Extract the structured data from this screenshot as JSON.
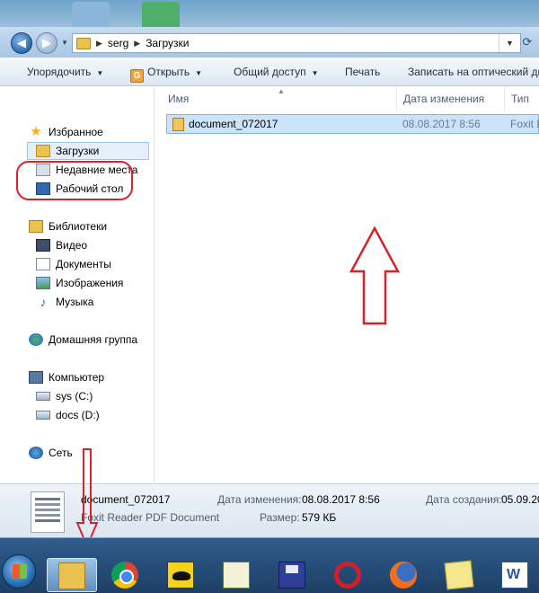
{
  "window": {
    "breadcrumb": [
      "serg",
      "Загрузки"
    ]
  },
  "toolbar": {
    "organize": "Упорядочить",
    "open": "Открыть",
    "share": "Общий доступ",
    "print": "Печать",
    "burn": "Записать на оптический диск"
  },
  "nav": {
    "favorites": "Избранное",
    "downloads": "Загрузки",
    "recent": "Недавние места",
    "desktop": "Рабочий стол",
    "libraries": "Библиотеки",
    "video": "Видео",
    "documents": "Документы",
    "images": "Изображения",
    "music": "Музыка",
    "homegroup": "Домашняя группа",
    "computer": "Компьютер",
    "drive_c": "sys (C:)",
    "drive_d": "docs (D:)",
    "network": "Сеть"
  },
  "columns": {
    "name": "Имя",
    "date_modified": "Дата изменения",
    "type": "Тип"
  },
  "files": [
    {
      "name": "document_072017",
      "date": "08.08.2017 8:56",
      "type": "Foxit R"
    }
  ],
  "details": {
    "name": "document_072017",
    "type": "Foxit Reader PDF Document",
    "modified_label": "Дата изменения:",
    "modified_value": "08.08.2017 8:56",
    "size_label": "Размер:",
    "size_value": "579 КБ",
    "created_label": "Дата создания:",
    "created_value": "05.09.20"
  },
  "taskbar": {
    "apps": [
      "explorer-icon",
      "chrome-icon",
      "batch-icon",
      "notepad-icon",
      "save-icon",
      "opera-icon",
      "firefox-icon",
      "sticky-notes-icon",
      "word-icon"
    ]
  },
  "colors": {
    "annotation_red": "#d92226",
    "selection": "#cce4f9"
  }
}
